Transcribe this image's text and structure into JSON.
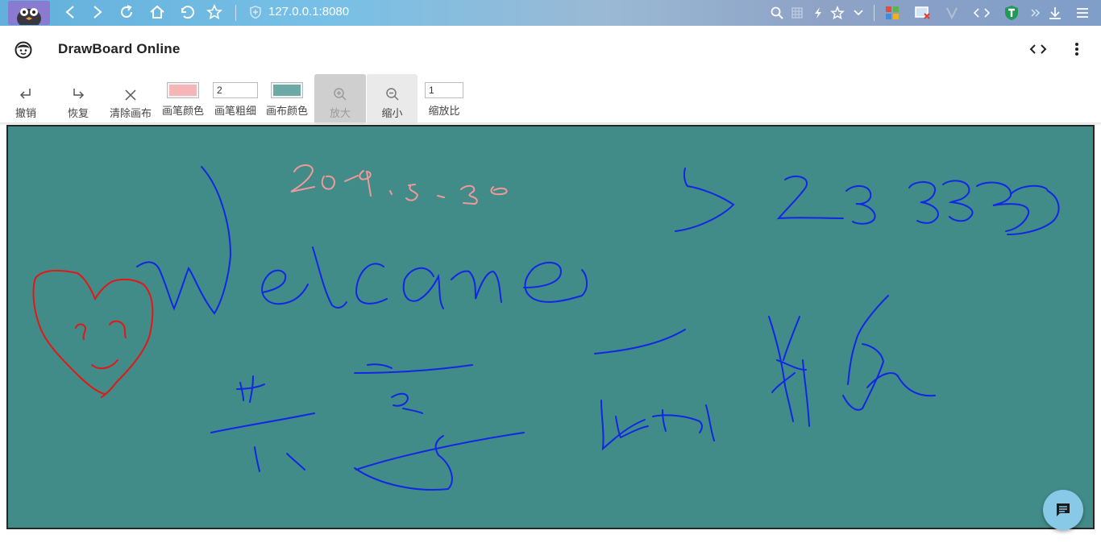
{
  "browser": {
    "url": "127.0.0.1:8080",
    "icons": [
      "back-icon",
      "forward-icon",
      "reload-icon",
      "home-icon",
      "undo-icon",
      "bookmark-star-icon",
      "shield-icon",
      "search-icon",
      "grid-icon",
      "bolt-icon",
      "star-icon",
      "chevron-down-icon",
      "apps-icon",
      "screenshot-icon",
      "v-icon",
      "code-icon",
      "extension-t-icon",
      "more-arrows-icon",
      "download-icon",
      "menu-icon"
    ]
  },
  "app": {
    "title": "DrawBoard Online"
  },
  "toolbar": {
    "undo_label": "撤销",
    "redo_label": "恢复",
    "clear_label": "清除画布",
    "pen_color_label": "画笔颜色",
    "pen_size_label": "画笔粗细",
    "canvas_color_label": "画布颜色",
    "zoom_in_label": "放大",
    "zoom_out_label": "缩小",
    "zoom_ratio_label": "缩放比",
    "pen_color": "#f6b6b7",
    "pen_size_value": "2",
    "canvas_color": "#6ea9a8",
    "zoom_ratio_value": "1"
  },
  "canvas": {
    "background": "#418c88",
    "drawing": {
      "date_text": "2019.5.30",
      "number_text": "5 233333",
      "welcome_text": "Welcome",
      "chinese_text": "共享画板"
    }
  },
  "colors": {
    "pen_pink": "#f19999",
    "pen_blue": "#1226e6",
    "pen_red": "#e41616",
    "fab": "#88c9e8"
  }
}
